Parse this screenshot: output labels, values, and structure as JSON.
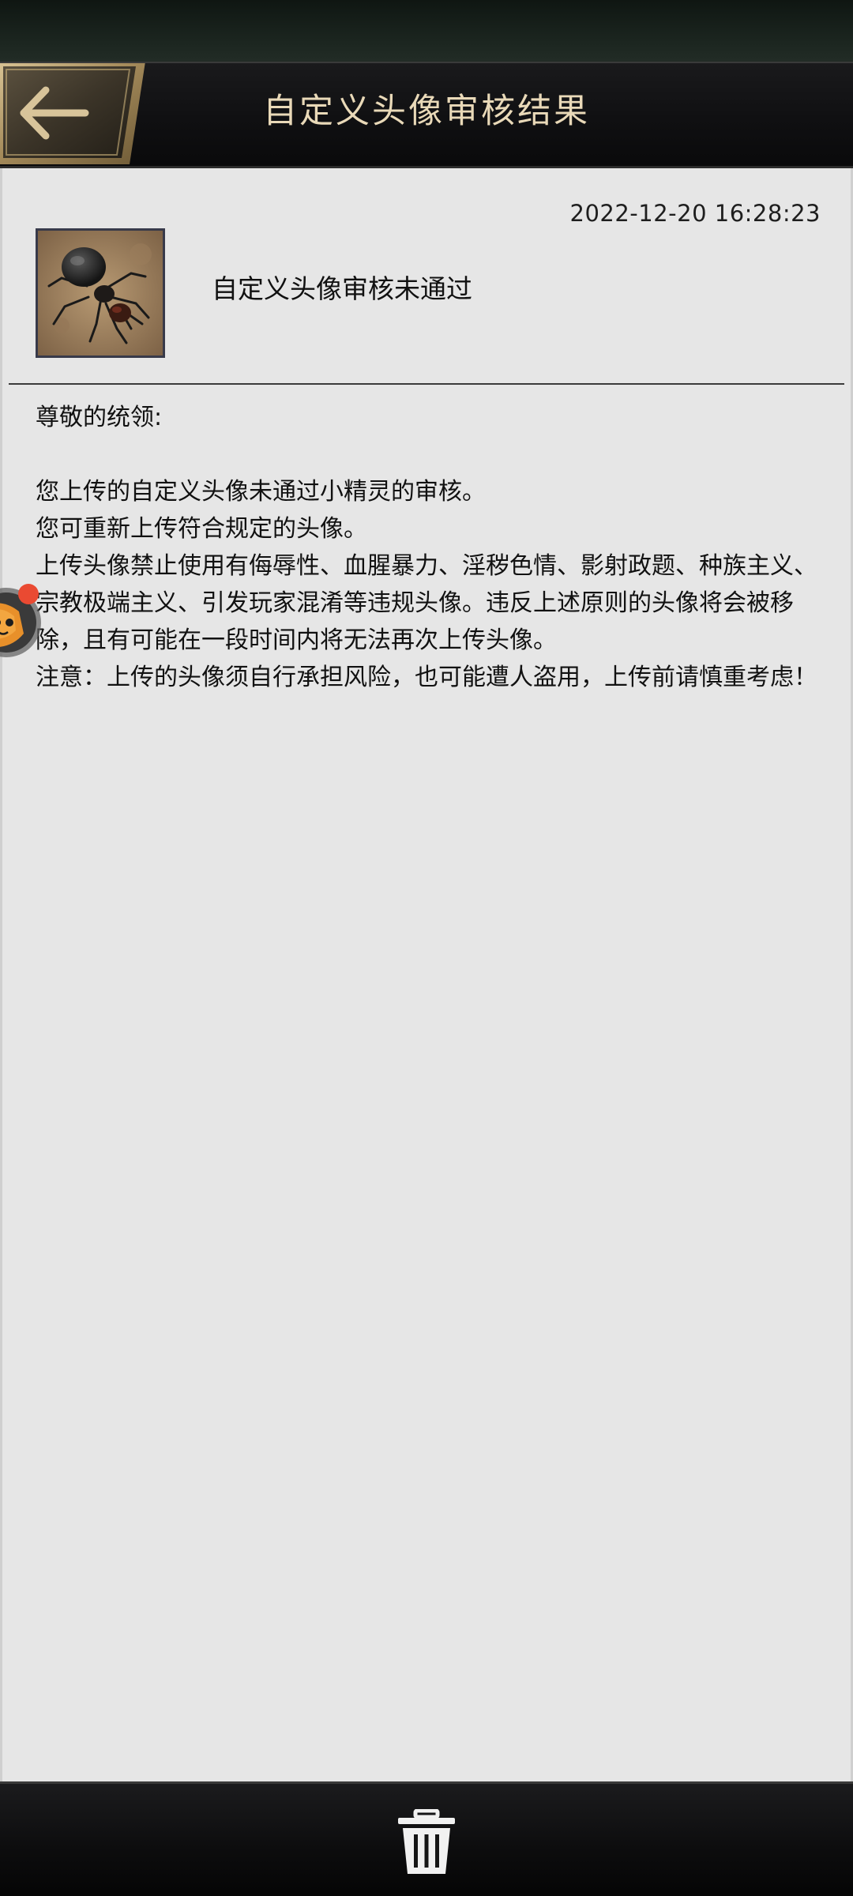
{
  "header": {
    "title": "自定义头像审核结果"
  },
  "mail": {
    "timestamp": "2022-12-20 16:28:23",
    "result_title": "自定义头像审核未通过",
    "salutation": "尊敬的统领:",
    "line1": "您上传的自定义头像未通过小精灵的审核。",
    "line2": "您可重新上传符合规定的头像。",
    "line3": "上传头像禁止使用有侮辱性、血腥暴力、淫秽色情、影射政题、种族主义、宗教极端主义、引发玩家混淆等违规头像。违反上述原则的头像将会被移除，且有可能在一段时间内将无法再次上传头像。",
    "line4": "注意：上传的头像须自行承担风险，也可能遭人盗用，上传前请慎重考虑！"
  },
  "icons": {
    "back": "back-arrow-icon",
    "avatar": "ant-avatar-image",
    "assistant": "floating-assistant-icon",
    "delete": "trash-icon"
  },
  "colors": {
    "title": "#e9d9b8",
    "content_background": "#e6e6e6",
    "header_background": "#101012",
    "back_button_gold": "#b49a68"
  }
}
